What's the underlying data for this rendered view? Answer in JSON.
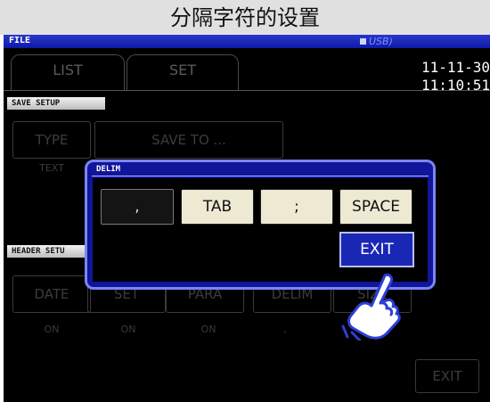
{
  "caption": "分隔字符的设置",
  "app": {
    "title": "FILE",
    "usb": "USB)"
  },
  "tabs": [
    {
      "label": "LIST"
    },
    {
      "label": "SET"
    }
  ],
  "datetime": "11-11-30 11:10:51",
  "save_setup": {
    "label": "SAVE SETUP",
    "type_label": "TYPE",
    "save_to_label": "SAVE TO ...",
    "type_value": "TEXT"
  },
  "header_setup": {
    "label": "HEADER SETU",
    "buttons": [
      "DATE",
      "SET",
      "PARA",
      "DELIM",
      "SIZE"
    ],
    "values": [
      "ON",
      "ON",
      "ON",
      ","
    ]
  },
  "exit_label": "EXIT",
  "dialog": {
    "title": "DELIM",
    "options": [
      ",",
      "TAB",
      ";",
      "SPACE"
    ],
    "selected": ",",
    "exit_label": "EXIT"
  },
  "colors": {
    "title_bar": "#1a27b4",
    "dialog_border": "#7a86f2",
    "option_bg": "#eee9d3",
    "exit_bg": "#1a27b4"
  }
}
